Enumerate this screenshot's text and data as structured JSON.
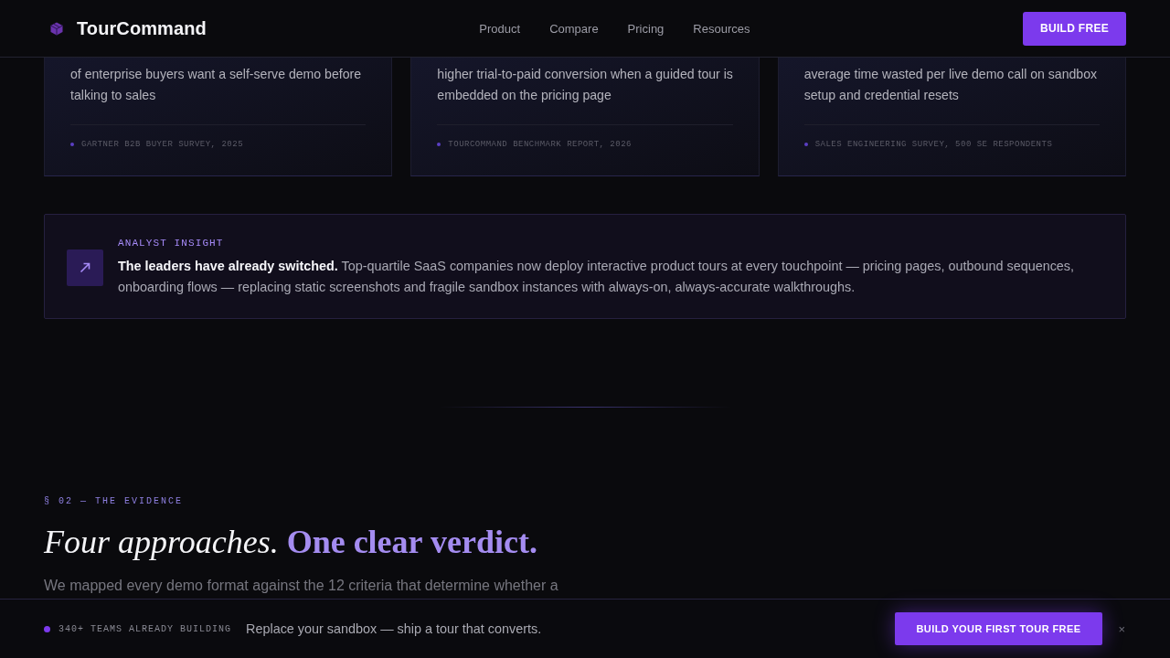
{
  "header": {
    "brand": "TourCommand",
    "nav": [
      "Product",
      "Compare",
      "Pricing",
      "Resources"
    ],
    "cta": "BUILD FREE"
  },
  "stats": [
    {
      "description": "of enterprise buyers want a self-serve demo before talking to sales",
      "source": "GARTNER B2B BUYER SURVEY, 2025"
    },
    {
      "description": "higher trial-to-paid conversion when a guided tour is embedded on the pricing page",
      "source": "TOURCOMMAND BENCHMARK REPORT, 2026"
    },
    {
      "description": "average time wasted per live demo call on sandbox setup and credential resets",
      "source": "SALES ENGINEERING SURVEY, 500 SE RESPONDENTS"
    }
  ],
  "insight": {
    "label": "ANALYST INSIGHT",
    "text": "**The leaders have already switched.** Top-quartile SaaS companies now deploy interactive product tours at every touchpoint — pricing pages, outbound sequences, onboarding flows — replacing static screenshots and fragile sandbox instances with always-on, always-accurate walkthroughs."
  },
  "section": {
    "eyebrow": "§ 02 — THE EVIDENCE",
    "heading": "*Four approaches.* **One clear verdict.**",
    "intro": "We mapped every demo format against the 12 criteria that determine whether a"
  },
  "cta_bar": {
    "badge": "340+ TEAMS ALREADY BUILDING",
    "message": "Replace your sandbox — ship a tour that converts.",
    "button": "BUILD YOUR FIRST TOUR FREE",
    "close": "×"
  }
}
